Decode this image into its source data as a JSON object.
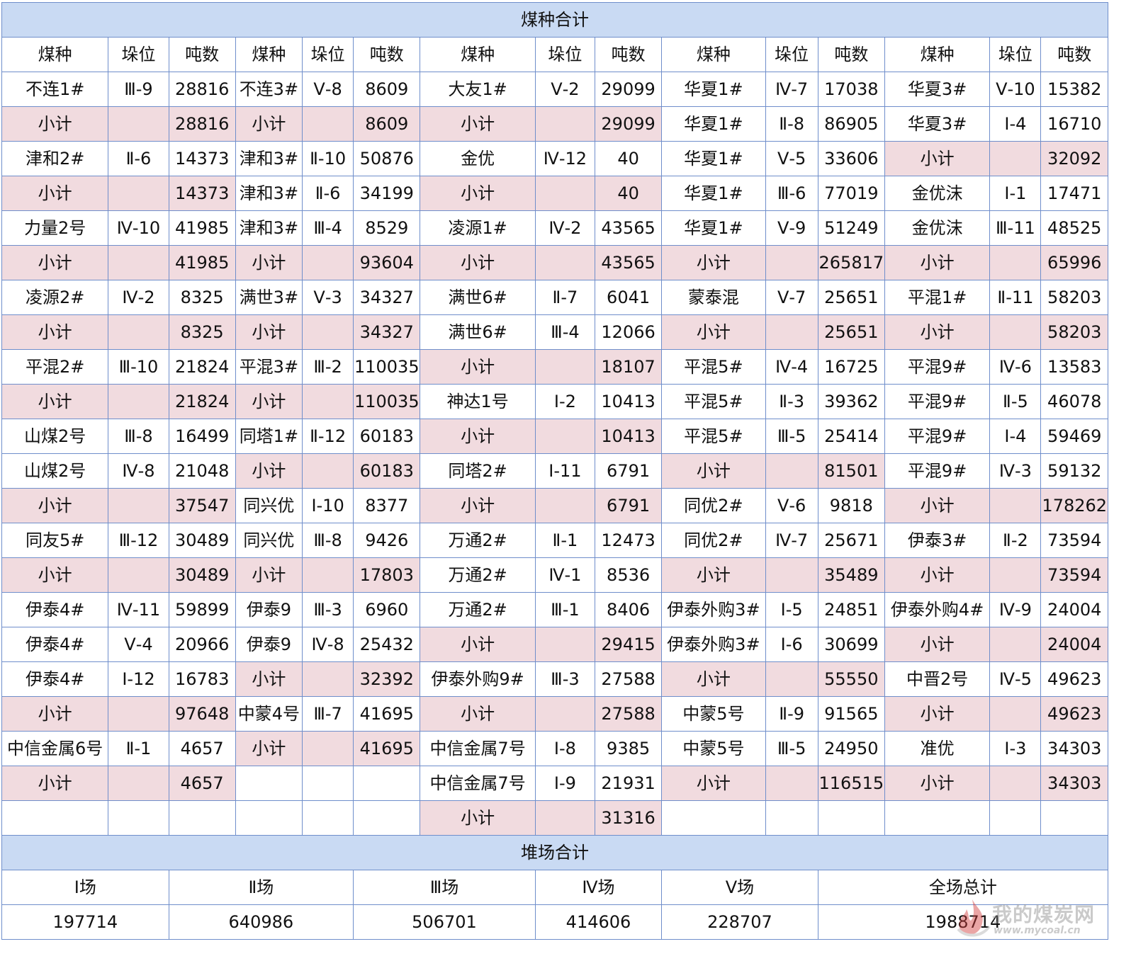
{
  "section1_title": "煤种合计",
  "headers": [
    "煤种",
    "垛位",
    "吨数",
    "煤种",
    "垛位",
    "吨数",
    "煤种",
    "垛位",
    "吨数",
    "煤种",
    "垛位",
    "吨数",
    "煤种",
    "垛位",
    "吨数"
  ],
  "columns": [
    [
      [
        "不连1#",
        "Ⅲ-9",
        "28816"
      ],
      [
        "小计",
        "",
        "28816"
      ],
      [
        "津和2#",
        "Ⅱ-6",
        "14373"
      ],
      [
        "小计",
        "",
        "14373"
      ],
      [
        "力量2号",
        "Ⅳ-10",
        "41985"
      ],
      [
        "小计",
        "",
        "41985"
      ],
      [
        "凌源2#",
        "Ⅳ-2",
        "8325"
      ],
      [
        "小计",
        "",
        "8325"
      ],
      [
        "平混2#",
        "Ⅲ-10",
        "21824"
      ],
      [
        "小计",
        "",
        "21824"
      ],
      [
        "山煤2号",
        "Ⅲ-8",
        "16499"
      ],
      [
        "山煤2号",
        "Ⅳ-8",
        "21048"
      ],
      [
        "小计",
        "",
        "37547"
      ],
      [
        "同友5#",
        "Ⅲ-12",
        "30489"
      ],
      [
        "小计",
        "",
        "30489"
      ],
      [
        "伊泰4#",
        "Ⅳ-11",
        "59899"
      ],
      [
        "伊泰4#",
        "Ⅴ-4",
        "20966"
      ],
      [
        "伊泰4#",
        "Ⅰ-12",
        "16783"
      ],
      [
        "小计",
        "",
        "97648"
      ],
      [
        "中信金属6号",
        "Ⅱ-1",
        "4657"
      ],
      [
        "小计",
        "",
        "4657"
      ],
      [
        "",
        "",
        ""
      ]
    ],
    [
      [
        "不连3#",
        "Ⅴ-8",
        "8609"
      ],
      [
        "小计",
        "",
        "8609"
      ],
      [
        "津和3#",
        "Ⅱ-10",
        "50876"
      ],
      [
        "津和3#",
        "Ⅱ-6",
        "34199"
      ],
      [
        "津和3#",
        "Ⅲ-4",
        "8529"
      ],
      [
        "小计",
        "",
        "93604"
      ],
      [
        "满世3#",
        "Ⅴ-3",
        "34327"
      ],
      [
        "小计",
        "",
        "34327"
      ],
      [
        "平混3#",
        "Ⅲ-2",
        "110035"
      ],
      [
        "小计",
        "",
        "110035"
      ],
      [
        "同塔1#",
        "Ⅱ-12",
        "60183"
      ],
      [
        "小计",
        "",
        "60183"
      ],
      [
        "同兴优",
        "Ⅰ-10",
        "8377"
      ],
      [
        "同兴优",
        "Ⅲ-8",
        "9426"
      ],
      [
        "小计",
        "",
        "17803"
      ],
      [
        "伊泰9",
        "Ⅲ-3",
        "6960"
      ],
      [
        "伊泰9",
        "Ⅳ-8",
        "25432"
      ],
      [
        "小计",
        "",
        "32392"
      ],
      [
        "中蒙4号",
        "Ⅲ-7",
        "41695"
      ],
      [
        "小计",
        "",
        "41695"
      ],
      [
        "",
        "",
        ""
      ],
      [
        "",
        "",
        ""
      ]
    ],
    [
      [
        "大友1#",
        "Ⅴ-2",
        "29099"
      ],
      [
        "小计",
        "",
        "29099"
      ],
      [
        "金优",
        "Ⅳ-12",
        "40"
      ],
      [
        "小计",
        "",
        "40"
      ],
      [
        "凌源1#",
        "Ⅳ-2",
        "43565"
      ],
      [
        "小计",
        "",
        "43565"
      ],
      [
        "满世6#",
        "Ⅱ-7",
        "6041"
      ],
      [
        "满世6#",
        "Ⅲ-4",
        "12066"
      ],
      [
        "小计",
        "",
        "18107"
      ],
      [
        "神达1号",
        "Ⅰ-2",
        "10413"
      ],
      [
        "小计",
        "",
        "10413"
      ],
      [
        "同塔2#",
        "Ⅰ-11",
        "6791"
      ],
      [
        "小计",
        "",
        "6791"
      ],
      [
        "万通2#",
        "Ⅱ-1",
        "12473"
      ],
      [
        "万通2#",
        "Ⅳ-1",
        "8536"
      ],
      [
        "万通2#",
        "Ⅲ-1",
        "8406"
      ],
      [
        "小计",
        "",
        "29415"
      ],
      [
        "伊泰外购9#",
        "Ⅲ-3",
        "27588"
      ],
      [
        "小计",
        "",
        "27588"
      ],
      [
        "中信金属7号",
        "Ⅰ-8",
        "9385"
      ],
      [
        "中信金属7号",
        "Ⅰ-9",
        "21931"
      ],
      [
        "小计",
        "",
        "31316"
      ]
    ],
    [
      [
        "华夏1#",
        "Ⅳ-7",
        "17038"
      ],
      [
        "华夏1#",
        "Ⅱ-8",
        "86905"
      ],
      [
        "华夏1#",
        "Ⅴ-5",
        "33606"
      ],
      [
        "华夏1#",
        "Ⅲ-6",
        "77019"
      ],
      [
        "华夏1#",
        "Ⅴ-9",
        "51249"
      ],
      [
        "小计",
        "",
        "265817"
      ],
      [
        "蒙泰混",
        "Ⅴ-7",
        "25651"
      ],
      [
        "小计",
        "",
        "25651"
      ],
      [
        "平混5#",
        "Ⅳ-4",
        "16725"
      ],
      [
        "平混5#",
        "Ⅱ-3",
        "39362"
      ],
      [
        "平混5#",
        "Ⅲ-5",
        "25414"
      ],
      [
        "小计",
        "",
        "81501"
      ],
      [
        "同优2#",
        "Ⅴ-6",
        "9818"
      ],
      [
        "同优2#",
        "Ⅳ-7",
        "25671"
      ],
      [
        "小计",
        "",
        "35489"
      ],
      [
        "伊泰外购3#",
        "Ⅰ-5",
        "24851"
      ],
      [
        "伊泰外购3#",
        "Ⅰ-6",
        "30699"
      ],
      [
        "小计",
        "",
        "55550"
      ],
      [
        "中蒙5号",
        "Ⅱ-9",
        "91565"
      ],
      [
        "中蒙5号",
        "Ⅲ-5",
        "24950"
      ],
      [
        "小计",
        "",
        "116515"
      ],
      [
        "",
        "",
        ""
      ]
    ],
    [
      [
        "华夏3#",
        "Ⅴ-10",
        "15382"
      ],
      [
        "华夏3#",
        "Ⅰ-4",
        "16710"
      ],
      [
        "小计",
        "",
        "32092"
      ],
      [
        "金优沫",
        "Ⅰ-1",
        "17471"
      ],
      [
        "金优沫",
        "Ⅲ-11",
        "48525"
      ],
      [
        "小计",
        "",
        "65996"
      ],
      [
        "平混1#",
        "Ⅱ-11",
        "58203"
      ],
      [
        "小计",
        "",
        "58203"
      ],
      [
        "平混9#",
        "Ⅳ-6",
        "13583"
      ],
      [
        "平混9#",
        "Ⅱ-5",
        "46078"
      ],
      [
        "平混9#",
        "Ⅰ-4",
        "59469"
      ],
      [
        "平混9#",
        "Ⅳ-3",
        "59132"
      ],
      [
        "小计",
        "",
        "178262"
      ],
      [
        "伊泰3#",
        "Ⅱ-2",
        "73594"
      ],
      [
        "小计",
        "",
        "73594"
      ],
      [
        "伊泰外购4#",
        "Ⅳ-9",
        "24004"
      ],
      [
        "小计",
        "",
        "24004"
      ],
      [
        "中晋2号",
        "Ⅳ-5",
        "49623"
      ],
      [
        "小计",
        "",
        "49623"
      ],
      [
        "准优",
        "Ⅰ-3",
        "34303"
      ],
      [
        "小计",
        "",
        "34303"
      ],
      [
        "",
        "",
        ""
      ]
    ]
  ],
  "section2_title": "堆场合计",
  "yard_headers": [
    "Ⅰ场",
    "Ⅱ场",
    "Ⅲ场",
    "Ⅳ场",
    "Ⅴ场",
    "全场总计"
  ],
  "yard_values": [
    "197714",
    "640986",
    "506701",
    "414606",
    "228707",
    "1988714"
  ],
  "watermark": {
    "name": "我的煤炭网",
    "url": "www.mycoal.cn",
    "icon": "flame-logo-icon"
  },
  "colors": {
    "header_bg": "#c9daf3",
    "subtotal_bg": "#f1dbdf",
    "border": "#6f8ecb"
  }
}
